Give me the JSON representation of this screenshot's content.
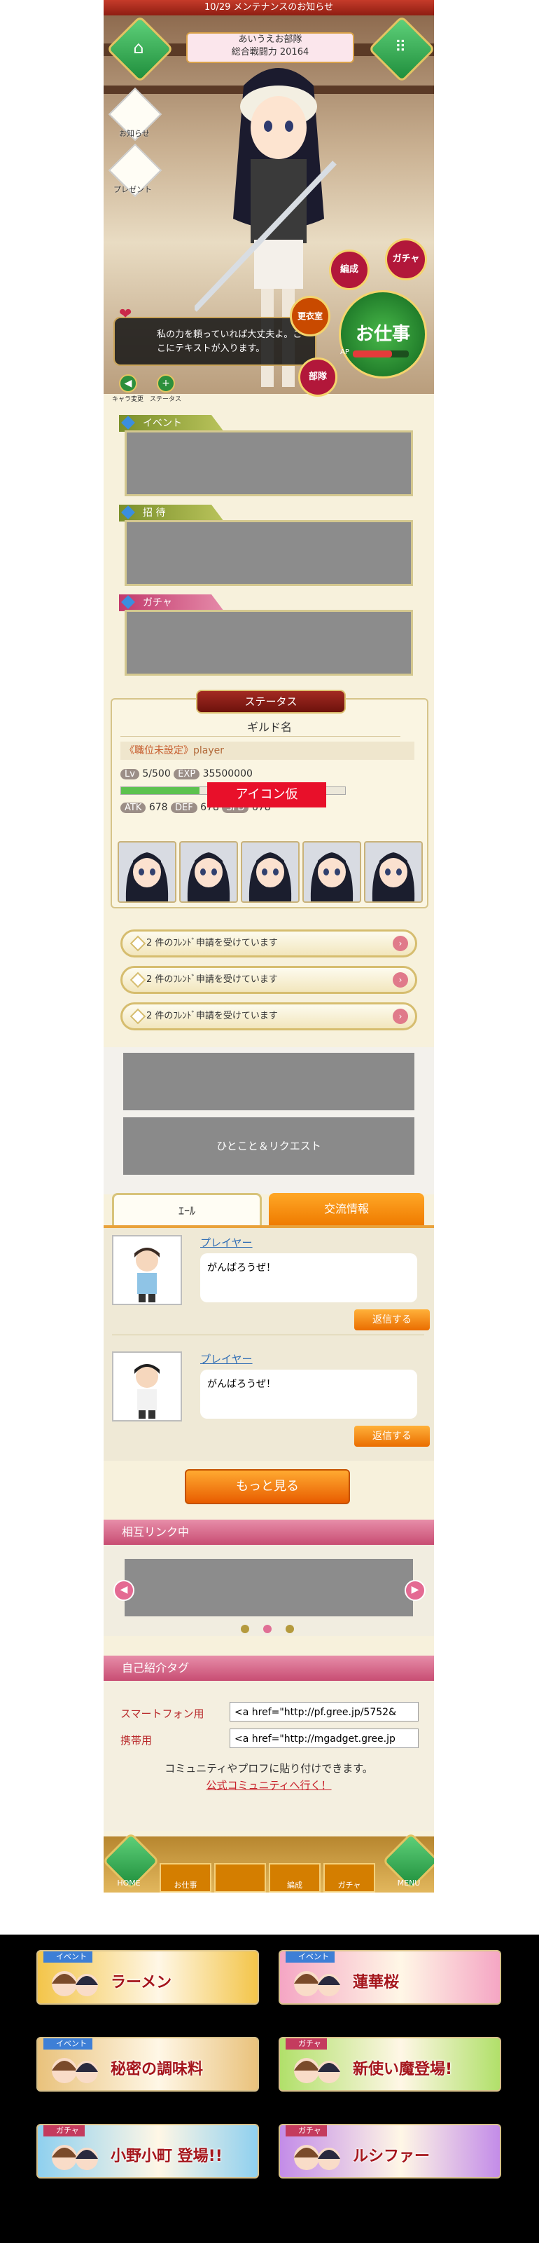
{
  "top": {
    "notice": "10/29 メンテナンスのお知らせ",
    "club_name": "あいうえお部隊",
    "power_label": "総合戦闘力",
    "power_value": "20164",
    "side_items": [
      "お知らせ",
      "プレゼント"
    ],
    "speech": "私の力を頼っていれば大丈夫よ。ここにテキストが入ります。",
    "buttons": {
      "gacha": "ガチャ",
      "edit": "編成",
      "wardrobe": "更衣室",
      "club": "部隊",
      "work": "お仕事",
      "ap": "AP"
    },
    "small_labels": [
      "キャラ変更",
      "ステータス"
    ]
  },
  "sections": {
    "event": "イベント",
    "invite": "招 待",
    "gacha": "ガチャ"
  },
  "status": {
    "title": "ステータス",
    "guild": "ギルド名",
    "job": "《職位未設定》",
    "player": "player",
    "lv_label": "Lv",
    "lv_value": "5/500",
    "exp_label": "EXP",
    "exp_value": "35500000",
    "exp_fraction": 0.35,
    "atk_label": "ATK",
    "atk_value": "678",
    "def_label": "DEF",
    "def_value": "678",
    "spd_label": "SPD",
    "spd_value": "678",
    "icon_temp": "アイコン仮",
    "card_count": 5
  },
  "requests": [
    "2 件のﾌﾚﾝﾄﾞ申請を受けています",
    "2 件のﾌﾚﾝﾄﾞ申請を受けています",
    "2 件のﾌﾚﾝﾄﾞ申請を受けています"
  ],
  "hitokoto": "ひとこと＆リクエスト",
  "tabs": {
    "yell": "ｴｰﾙ",
    "exchange": "交流情報"
  },
  "posts": [
    {
      "name": "プレイヤー",
      "message": "がんばろうぜ！",
      "reply": "返信する"
    },
    {
      "name": "プレイヤー",
      "message": "がんばろうぜ！",
      "reply": "返信する"
    }
  ],
  "more_button": "もっと見る",
  "mutual_link": {
    "title": "相互リンク中"
  },
  "intro": {
    "title": "自己紹介タグ",
    "smartphone_label": "スマートフォン用",
    "smartphone_value": "<a href=\"http://pf.gree.jp/5752&",
    "mobile_label": "携帯用",
    "mobile_value": "<a href=\"http://mgadget.gree.jp",
    "note": "コミュニティやプロフに貼り付けできます。",
    "link": "公式コミュニティへ行く！"
  },
  "nav": {
    "home": "HOME",
    "work": "お仕事",
    "edit": "編成",
    "gacha": "ガチャ",
    "menu": "MENU"
  },
  "banners": [
    {
      "tag": "イベント",
      "title": "ラーメン",
      "color": "#f3c54a"
    },
    {
      "tag": "イベント",
      "title": "蓮華桜",
      "color": "#f5a6c4"
    },
    {
      "tag": "イベント",
      "title": "秘密の調味料",
      "color": "#e9c27c"
    },
    {
      "tag": "ガチャ",
      "title": "新使い魔登場!",
      "color": "#b1e06a"
    },
    {
      "tag": "ガチャ",
      "title": "小野小町 登場!!",
      "color": "#8fd0ef"
    },
    {
      "tag": "ガチャ",
      "title": "ルシファー",
      "color": "#c38ce8"
    }
  ]
}
